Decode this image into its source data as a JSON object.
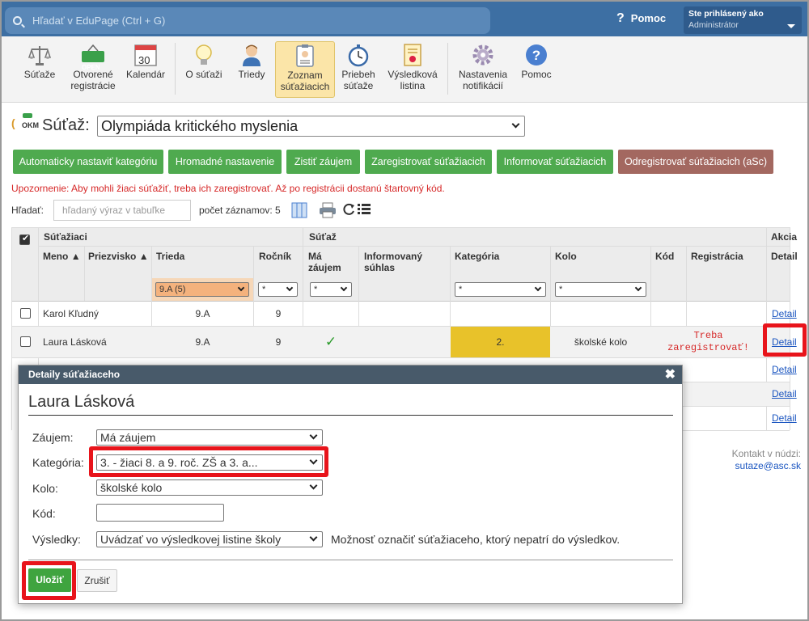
{
  "topbar": {
    "search_placeholder": "Hľadať v EduPage (Ctrl + G)",
    "help": "Pomoc",
    "login_line1": "Ste prihlásený ako",
    "login_line2": "Administrátor"
  },
  "toolbar": [
    {
      "label": "Súťaže"
    },
    {
      "label": "Otvorené registrácie",
      "badge": "OPEN"
    },
    {
      "label": "Kalendár",
      "day": "30"
    },
    {
      "label": "O súťaži"
    },
    {
      "label": "Triedy"
    },
    {
      "label": "Zoznam súťažiacich"
    },
    {
      "label": "Priebeh súťaže"
    },
    {
      "label": "Výsledková listina"
    },
    {
      "label": "Nastavenia notifikácií"
    },
    {
      "label": "Pomoc"
    }
  ],
  "heading": {
    "logo_text": "OKM",
    "label": "Súťaž:",
    "selected_contest": "Olympiáda kritického myslenia"
  },
  "actions": [
    "Automaticky nastaviť kategóriu",
    "Hromadné nastavenie",
    "Zistiť záujem",
    "Zaregistrovať súťažiacich",
    "Informovať súťažiacich",
    "Odregistrovať súťažiacich (aSc)"
  ],
  "warning": "Upozornenie: Aby mohli žiaci súťažiť, treba ich zaregistrovať. Až po registrácii dostanú štartovný kód.",
  "filterbar": {
    "search_label": "Hľadať:",
    "search_placeholder": "hľadaný výraz v tabuľke",
    "count_label": "počet záznamov: 5"
  },
  "table": {
    "group_students": "Súťažiaci",
    "group_contest": "Súťaž",
    "group_action": "Akcia",
    "col_name": "Meno",
    "col_surname": "Priezvisko",
    "col_class": "Trieda",
    "col_year": "Ročník",
    "col_interest": "Má záujem",
    "col_consent": "Informovaný súhlas",
    "col_category": "Kategória",
    "col_round": "Kolo",
    "col_code": "Kód",
    "col_registration": "Registrácia",
    "col_detail": "Detail",
    "filter_class": "9.A (5)",
    "filter_any": "*",
    "rows": [
      {
        "name": "Karol Kľudný",
        "class": "9.A",
        "year": "9",
        "detail": "Detail"
      },
      {
        "name": "Laura Lásková",
        "class": "9.A",
        "year": "9",
        "interest": "✓",
        "category": "2.",
        "round": "školské kolo",
        "registration": "Treba zaregistrovať!",
        "detail": "Detail"
      },
      {
        "detail": "Detail"
      },
      {
        "detail": "Detail"
      },
      {
        "detail": "Detail"
      }
    ]
  },
  "contact": {
    "label": "Kontakt v núdzi:",
    "email": "sutaze@asc.sk"
  },
  "dialog": {
    "title": "Detaily súťažiaceho",
    "close": "✖",
    "student_name": "Laura Lásková",
    "interest_label": "Záujem:",
    "interest_value": "Má záujem",
    "category_label": "Kategória:",
    "category_value": "3. - žiaci 8. a 9. roč. ZŠ a 3. a...",
    "round_label": "Kolo:",
    "round_value": "školské kolo",
    "code_label": "Kód:",
    "code_value": "",
    "results_label": "Výsledky:",
    "results_value": "Uvádzať vo výsledkovej listine školy",
    "results_note": "Možnosť označiť súťažiaceho, ktorý nepatrí do výsledkov.",
    "save": "Uložiť",
    "cancel": "Zrušiť"
  },
  "colors": {
    "topbar": "#3d6fa3",
    "green_button": "#4faa4f",
    "red_button": "#a36860",
    "highlight": "#e8141b",
    "category_cell": "#e8c22a",
    "class_filter": "#f4b27d"
  }
}
